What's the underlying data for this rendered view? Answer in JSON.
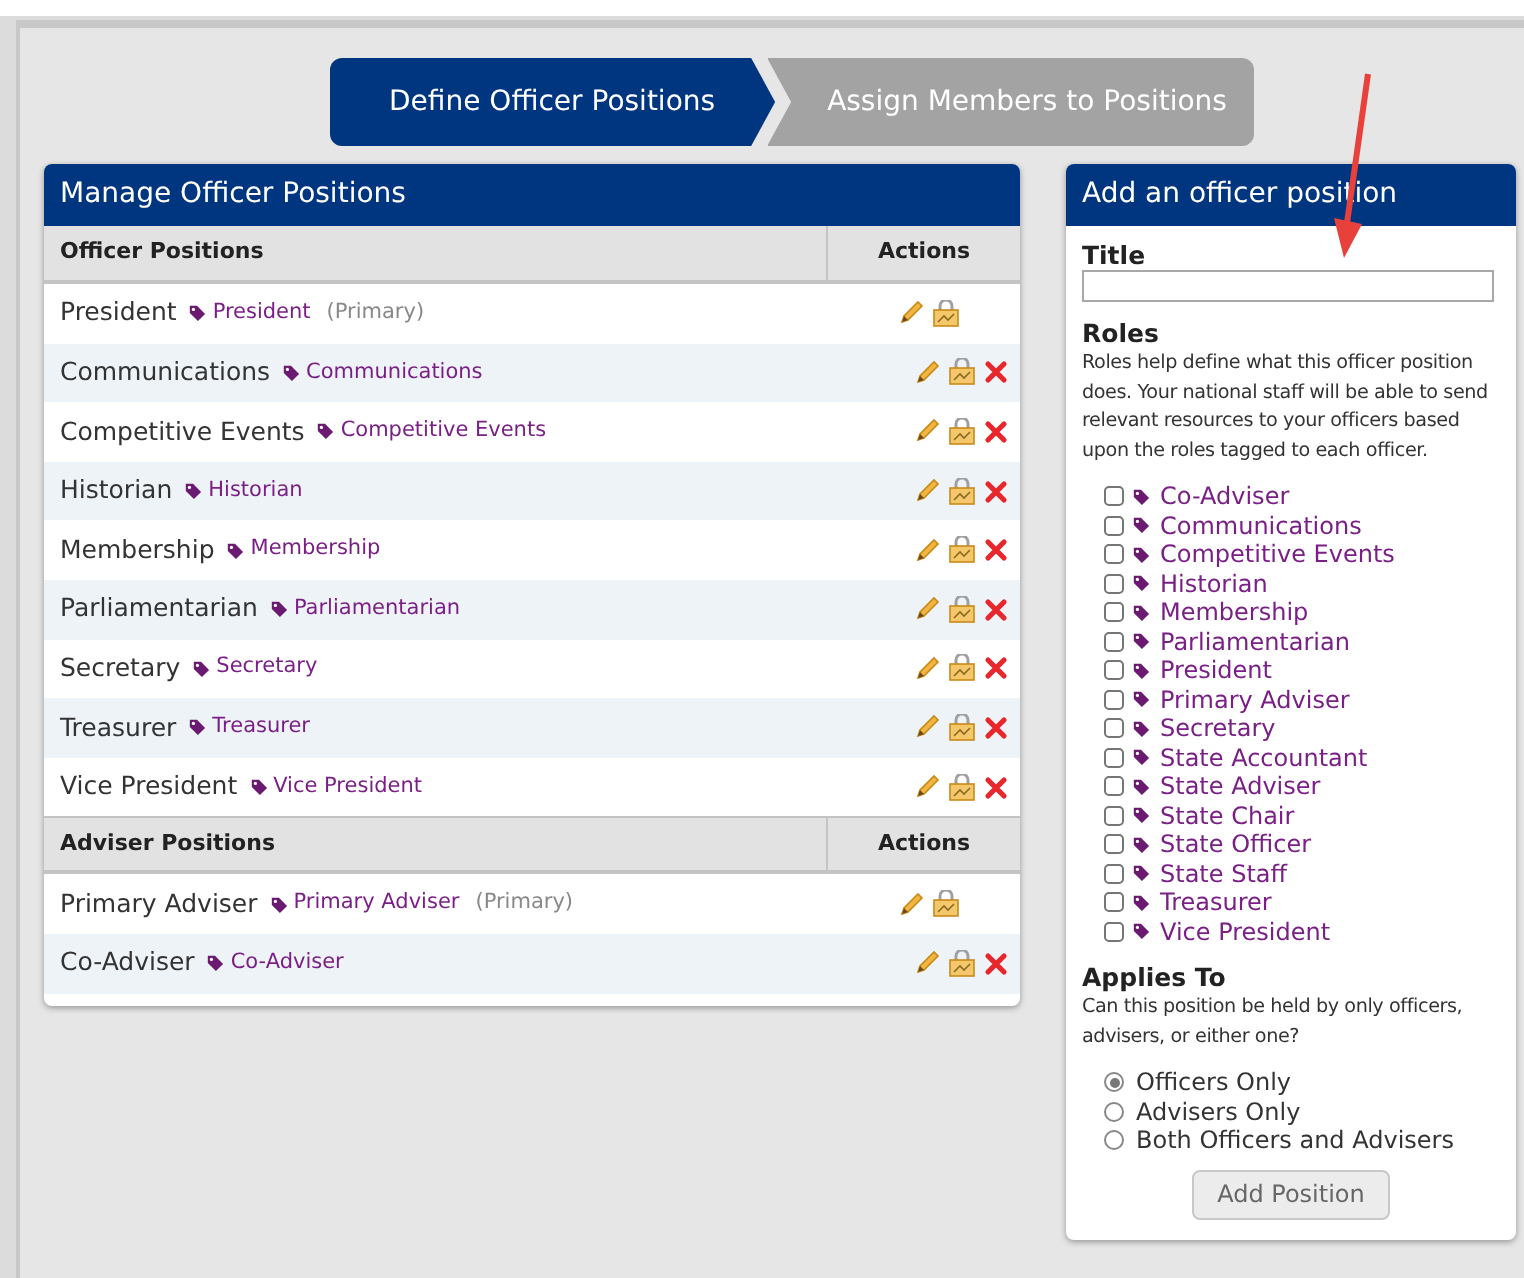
{
  "steps": [
    {
      "label": "Define Officer Positions",
      "selected": true
    },
    {
      "label": "Assign Members to Positions",
      "selected": false
    }
  ],
  "manage_panel": {
    "title": "Manage Officer Positions",
    "sections": [
      {
        "heading": "Officer Positions",
        "actions_heading": "Actions",
        "rows": [
          {
            "name": "President",
            "role": "President",
            "note": "(Primary)",
            "deletable": false
          },
          {
            "name": "Communications",
            "role": "Communications",
            "deletable": true
          },
          {
            "name": "Competitive Events",
            "role": "Competitive Events",
            "deletable": true
          },
          {
            "name": "Historian",
            "role": "Historian",
            "deletable": true
          },
          {
            "name": "Membership",
            "role": "Membership",
            "deletable": true
          },
          {
            "name": "Parliamentarian",
            "role": "Parliamentarian",
            "deletable": true
          },
          {
            "name": "Secretary",
            "role": "Secretary",
            "deletable": true
          },
          {
            "name": "Treasurer",
            "role": "Treasurer",
            "deletable": true
          },
          {
            "name": "Vice President",
            "role": "Vice President",
            "deletable": true
          }
        ]
      },
      {
        "heading": "Adviser Positions",
        "actions_heading": "Actions",
        "rows": [
          {
            "name": "Primary Adviser",
            "role": "Primary Adviser",
            "note": "(Primary)",
            "deletable": false
          },
          {
            "name": "Co-Adviser",
            "role": "Co-Adviser",
            "deletable": true
          }
        ]
      }
    ]
  },
  "add_panel": {
    "title": "Add an officer position",
    "title_label": "Title",
    "roles_heading": "Roles",
    "roles_help": "Roles help define what this officer position does. Your national staff will be able to send relevant resources to your officers based upon the roles tagged to each officer.",
    "roles": [
      {
        "label": "Co-Adviser",
        "checked": false
      },
      {
        "label": "Communications",
        "checked": false
      },
      {
        "label": "Competitive Events",
        "checked": false
      },
      {
        "label": "Historian",
        "checked": false
      },
      {
        "label": "Membership",
        "checked": false
      },
      {
        "label": "Parliamentarian",
        "checked": false
      },
      {
        "label": "President",
        "checked": false
      },
      {
        "label": "Primary Adviser",
        "checked": false
      },
      {
        "label": "Secretary",
        "checked": false
      },
      {
        "label": "State Accountant",
        "checked": false
      },
      {
        "label": "State Adviser",
        "checked": false
      },
      {
        "label": "State Chair",
        "checked": false
      },
      {
        "label": "State Officer",
        "checked": false
      },
      {
        "label": "State Staff",
        "checked": false
      },
      {
        "label": "Treasurer",
        "checked": false
      },
      {
        "label": "Vice President",
        "checked": false
      }
    ],
    "applies_heading": "Applies To",
    "applies_help": "Can this position be held by only officers, advisers, or either one?",
    "applies_options": [
      {
        "label": "Officers Only",
        "selected": true
      },
      {
        "label": "Advisers Only",
        "selected": false
      },
      {
        "label": "Both Officers and Advisers",
        "selected": false
      }
    ],
    "submit": "Add Position"
  }
}
